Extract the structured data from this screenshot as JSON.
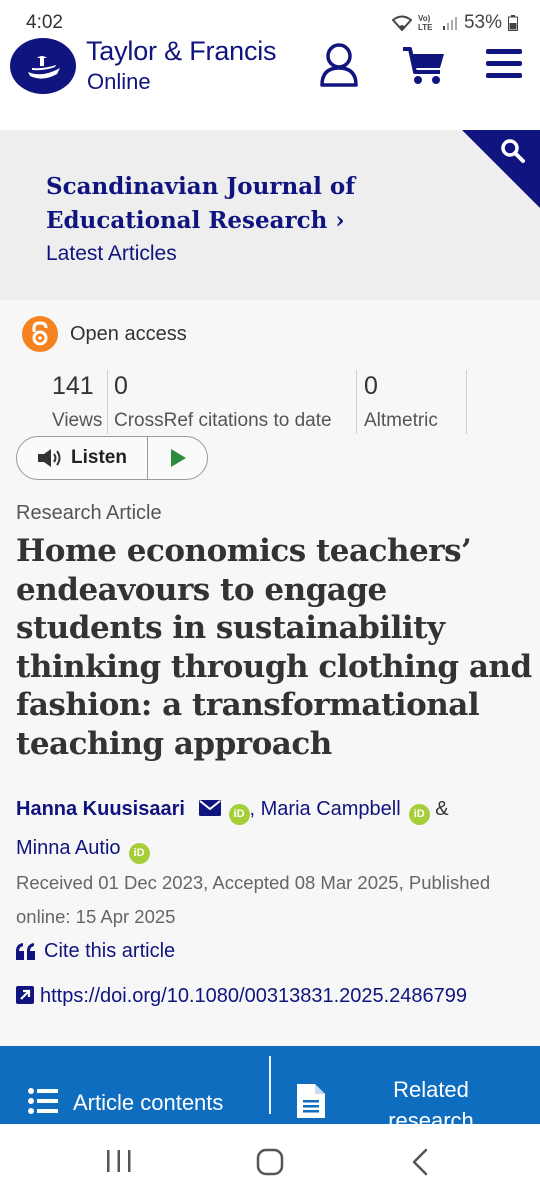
{
  "status_bar": {
    "time": "4:02",
    "network": "Vo) LTE",
    "battery": "53%"
  },
  "header": {
    "brand_name": "Taylor & Francis",
    "brand_sub": "Online",
    "icons": [
      "account-icon",
      "cart-icon",
      "menu-icon"
    ],
    "brand_color": "#10147e"
  },
  "journal": {
    "title": "Scandinavian Journal of Educational Research",
    "chevron": "›",
    "subtitle": "Latest Articles"
  },
  "article": {
    "access_label": "Open access",
    "metrics": [
      {
        "value": "141",
        "label": "Views"
      },
      {
        "value": "0",
        "label": "CrossRef citations to date"
      },
      {
        "value": "0",
        "label": "Altmetric"
      }
    ],
    "listen_label": "Listen",
    "type": "Research Article",
    "title": "Home economics teachers’ endeavours to engage students in sustainability thinking through clothing and fashion: a transformational teaching approach",
    "authors": [
      {
        "name": "Hanna Kuusisaari",
        "corresponding": true,
        "orcid": true
      },
      {
        "name": "Maria Campbell",
        "corresponding": false,
        "orcid": true
      },
      {
        "name": "Minna Autio",
        "corresponding": false,
        "orcid": true
      }
    ],
    "author_separators": [
      ",",
      "&"
    ],
    "orcid_badge": "iD",
    "dates": "Received 01 Dec 2023, Accepted 08 Mar 2025, Published online: 15 Apr 2025",
    "cite_label": "Cite this article",
    "doi": "https://doi.org/10.1080/00313831.2025.2486799"
  },
  "bottom_tabs": {
    "contents_label": "Article contents",
    "related_label": "Related research",
    "color": "#0e6dbf"
  },
  "android_nav": {
    "buttons": [
      "recents-icon",
      "home-icon",
      "back-icon"
    ]
  }
}
